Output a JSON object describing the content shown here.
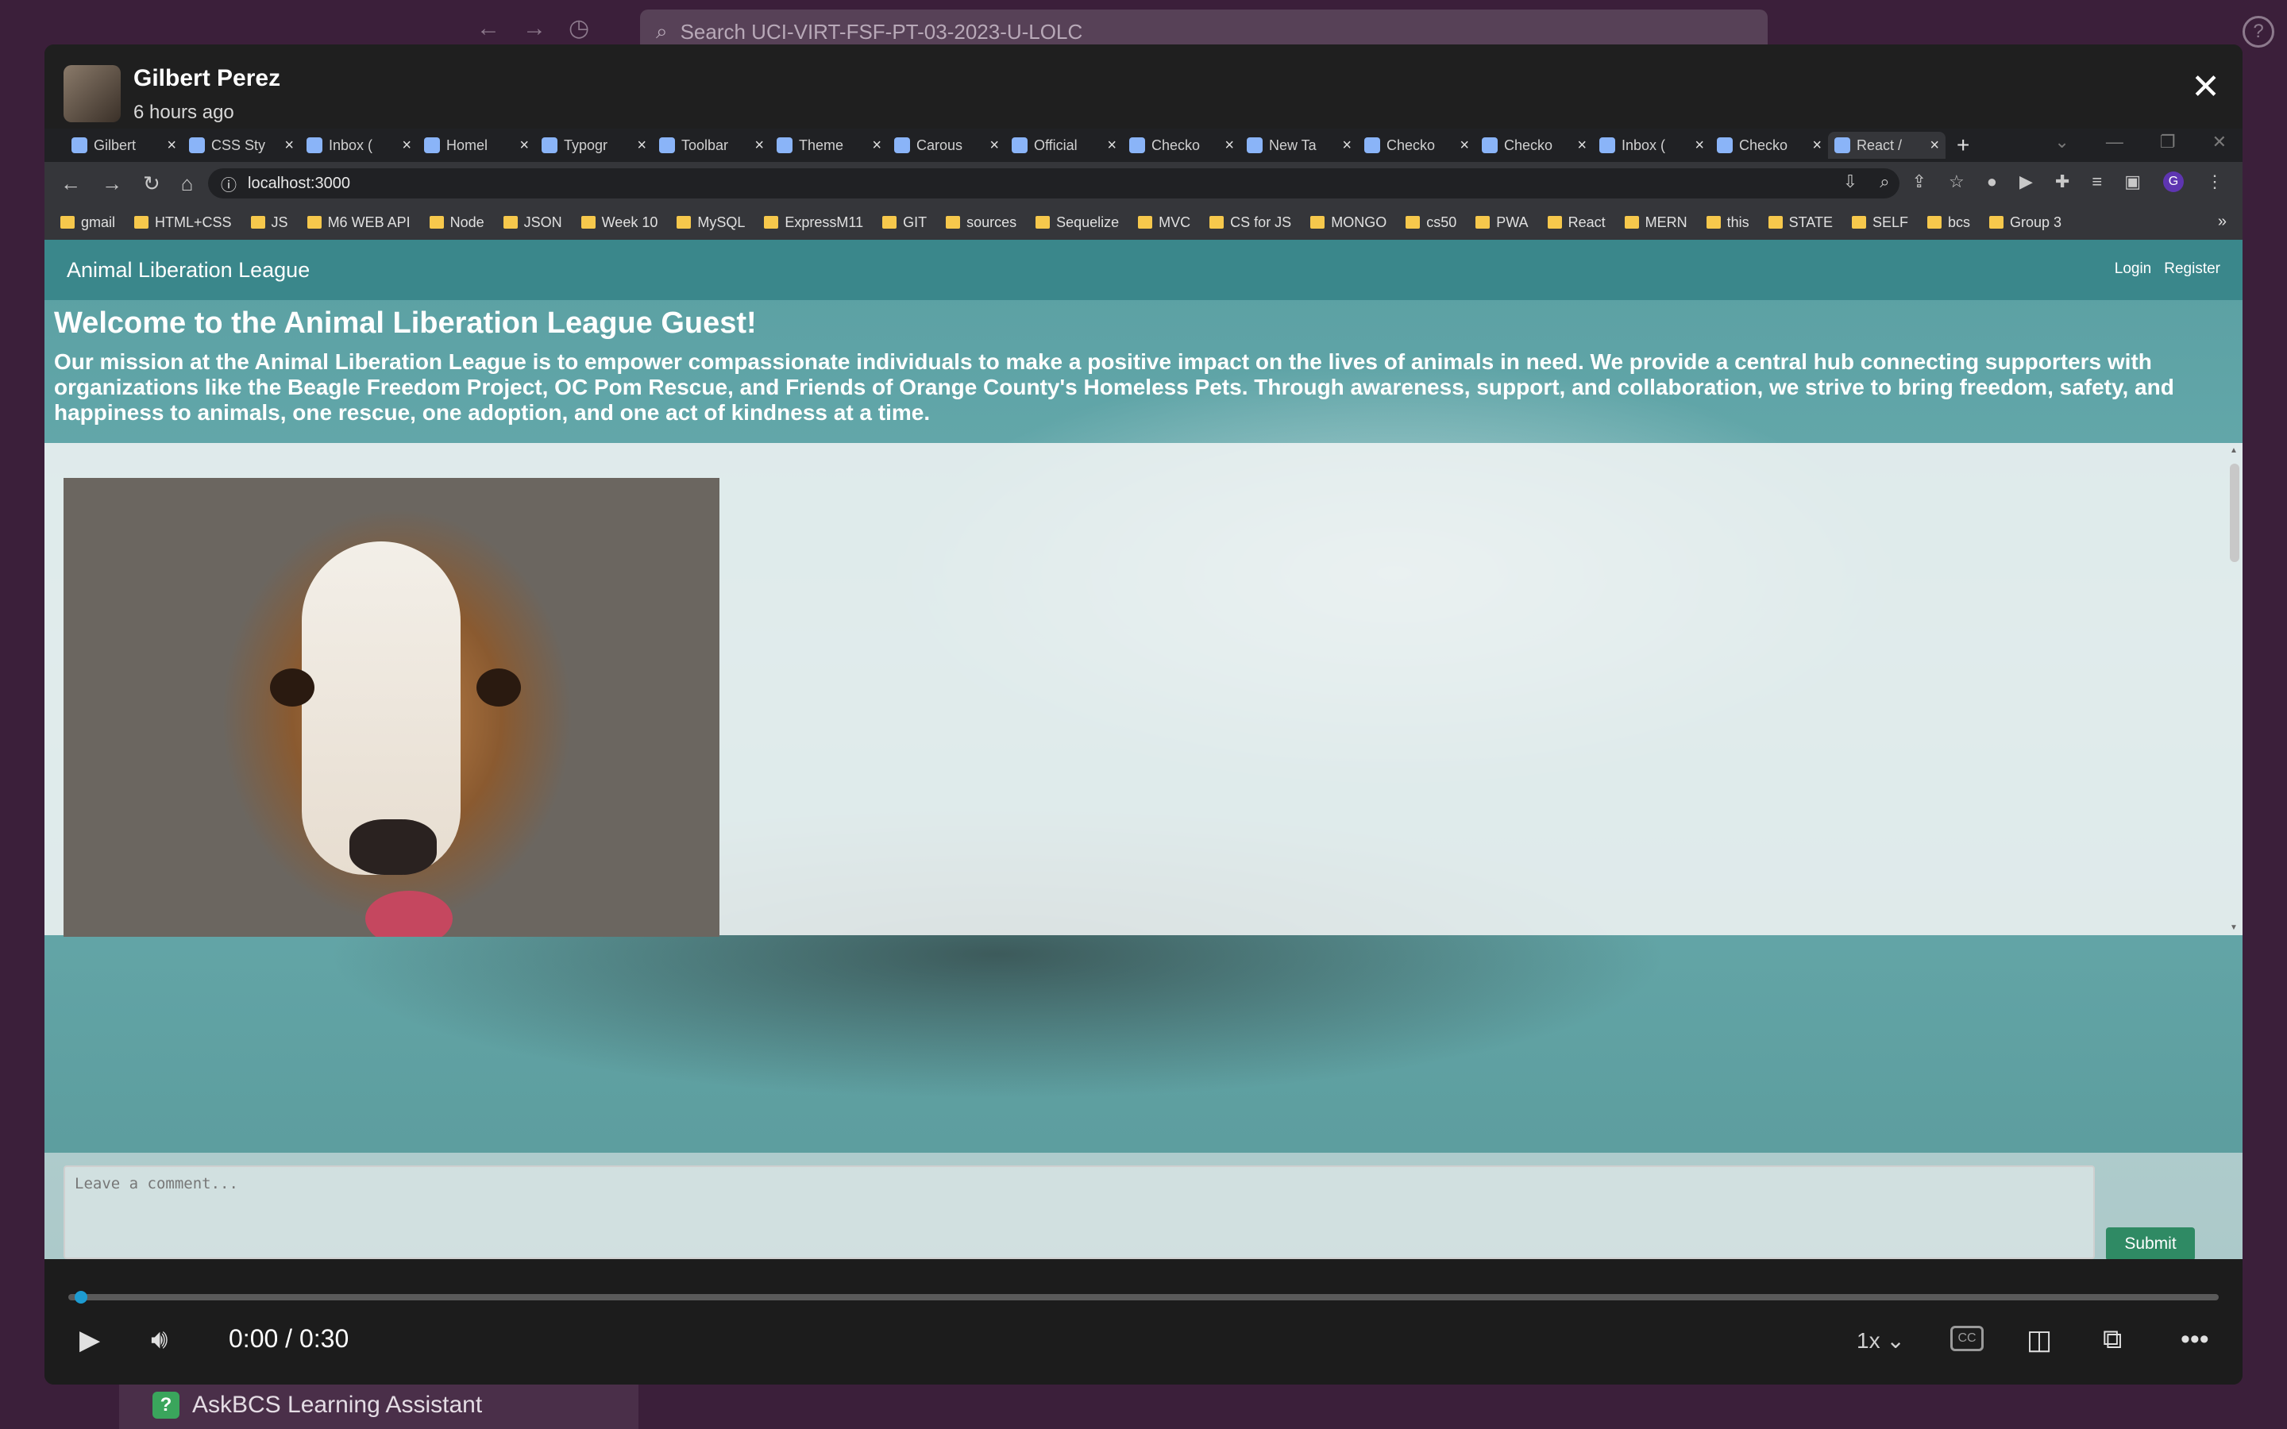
{
  "background": {
    "search_placeholder": "Search UCI-VIRT-FSF-PT-03-2023-U-LOLC",
    "bottom_item": "AskBCS Learning Assistant"
  },
  "video": {
    "uploader": "Gilbert Perez",
    "posted": "6 hours ago",
    "time": "0:00 / 0:30",
    "speed": "1x",
    "progress": 0
  },
  "browser": {
    "tabs": [
      {
        "label": "Gilbert",
        "icon": "globe-icon"
      },
      {
        "label": "CSS Sty",
        "icon": "page-icon"
      },
      {
        "label": "Inbox (",
        "icon": "gmail-icon"
      },
      {
        "label": "Homel",
        "icon": "github-icon"
      },
      {
        "label": "Typogr",
        "icon": "mui-icon"
      },
      {
        "label": "Toolbar",
        "icon": "mui-icon"
      },
      {
        "label": "Theme",
        "icon": "mui-icon"
      },
      {
        "label": "Carous",
        "icon": "react-icon"
      },
      {
        "label": "Official",
        "icon": "bootstrap-icon"
      },
      {
        "label": "Checko",
        "icon": "stripe-icon"
      },
      {
        "label": "New Ta",
        "icon": "chrome-icon"
      },
      {
        "label": "Checko",
        "icon": "stripe-icon"
      },
      {
        "label": "Checko",
        "icon": "stripe-icon"
      },
      {
        "label": "Inbox (",
        "icon": "gmail-icon"
      },
      {
        "label": "Checko",
        "icon": "stripe-icon"
      },
      {
        "label": "React /",
        "icon": "react-icon"
      }
    ],
    "url": "localhost:3000",
    "bookmarks": [
      "gmail",
      "HTML+CSS",
      "JS",
      "M6 WEB API",
      "Node",
      "JSON",
      "Week 10",
      "MySQL",
      "ExpressM11",
      "GIT",
      "sources",
      "Sequelize",
      "MVC",
      "CS for JS",
      "MONGO",
      "cs50",
      "PWA",
      "React",
      "MERN",
      "this",
      "STATE",
      "SELF",
      "bcs",
      "Group 3"
    ],
    "profile_initial": "G"
  },
  "site": {
    "brand": "Animal Liberation League",
    "login": "Login",
    "register": "Register",
    "welcome": "Welcome to the Animal Liberation League Guest!",
    "mission": "Our mission at the Animal Liberation League is to empower compassionate individuals to make a positive impact on the lives of animals in need. We provide a central hub connecting supporters with organizations like the Beagle Freedom Project, OC Pom Rescue, and Friends of Orange County's Homeless Pets. Through awareness, support, and collaboration, we strive to bring freedom, safety, and happiness to animals, one rescue, one adoption, and one act of kindness at a time.",
    "comment_placeholder": "Leave a comment...",
    "submit": "Submit"
  },
  "colors": {
    "navbar": "#3a878b",
    "submit": "#2f8a64",
    "progress": "#1d9bd1"
  }
}
